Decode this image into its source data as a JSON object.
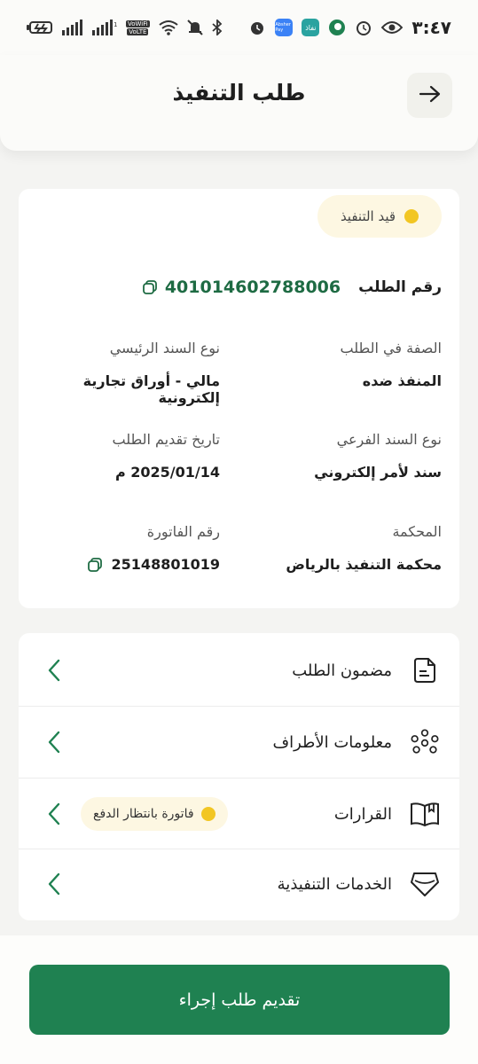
{
  "status_bar": {
    "time": "٣:٤٧",
    "app_label_1": "نفاذ",
    "app_label_2": "Absher Pay",
    "wifi_label": "VoWiFi",
    "volte_label": "VoLTE"
  },
  "header": {
    "title": "طلب التنفيذ"
  },
  "request": {
    "status": "قيد التنفيذ",
    "number_label": "رقم الطلب",
    "number": "401014602788006",
    "fields": {
      "capacity_label": "الصفة في الطلب",
      "capacity_value": "المنفذ ضده",
      "main_doc_label": "نوع السند الرئيسي",
      "main_doc_value": "مالي - أوراق تجارية إلكترونية",
      "sub_doc_label": "نوع السند الفرعي",
      "sub_doc_value": "سند لأمر إلكتروني",
      "date_label": "تاريخ تقديم الطلب",
      "date_value": "2025/01/14 م",
      "court_label": "المحكمة",
      "court_value": "محكمة التنفيذ بالرياض",
      "invoice_label": "رقم الفاتورة",
      "invoice_value": "25148801019"
    }
  },
  "menu": {
    "items": [
      {
        "label": "مضمون الطلب"
      },
      {
        "label": "معلومات الأطراف"
      },
      {
        "label": "القرارات",
        "badge": "فاتورة بانتظار الدفع"
      },
      {
        "label": "الخدمات التنفيذية"
      }
    ]
  },
  "footer": {
    "action_label": "تقديم طلب إجراء"
  },
  "colors": {
    "primary_green": "#1f8151",
    "number_green": "#1e6b43",
    "status_yellow": "#f2c623",
    "pill_bg": "#fdf7e2"
  }
}
